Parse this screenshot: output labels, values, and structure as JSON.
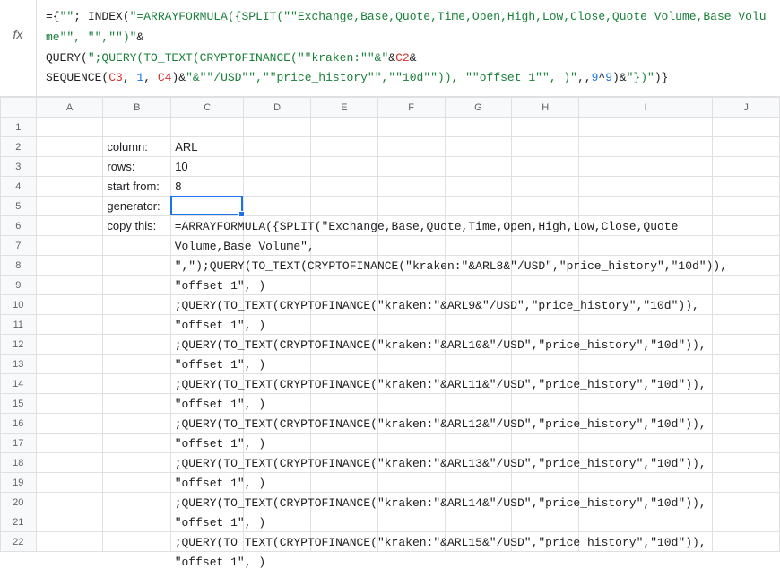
{
  "formula_bar": {
    "fx_label": "fx",
    "line1_part1": "={",
    "line1_str1": "\"\"",
    "line1_part2": "; INDEX(",
    "line1_str2": "\"=ARRAYFORMULA({SPLIT(\"\"Exchange,Base,Quote,Time,Open,High,Low,Close,Quote Volume,Base Volume\"\", \"\",\"\")\"",
    "line1_part3": "&",
    "line2_part1": "QUERY(",
    "line2_str1": "\";QUERY(TO_TEXT(CRYPTOFINANCE(\"\"kraken:\"\"&\"",
    "line2_part2": "&",
    "line2_ref1": "C2",
    "line2_part3": "&",
    "line3_part1": "SEQUENCE(",
    "line3_ref1": "C3",
    "line3_part2": ", ",
    "line3_num1": "1",
    "line3_part3": ", ",
    "line3_ref2": "C4",
    "line3_part4": ")&",
    "line3_str1": "\"&\"\"/USD\"\",\"\"price_history\"\",\"\"10d\"\")), \"\"offset 1\"\", )\"",
    "line3_part5": ",,",
    "line3_num2": "9",
    "line3_part6": "^",
    "line3_num3": "9",
    "line3_part7": ")&",
    "line3_str2": "\"})\"",
    "line3_part8": ")}"
  },
  "columns": [
    "A",
    "B",
    "C",
    "D",
    "E",
    "F",
    "G",
    "H",
    "I",
    "J"
  ],
  "row_count": 22,
  "cells": {
    "B2": "column:",
    "C2": "ARL",
    "B3": "rows:",
    "C3": "10",
    "B4": "start from:",
    "C4": "8",
    "B5": "generator:",
    "B6": "copy this:"
  },
  "overflow_c6": "=ARRAYFORMULA({SPLIT(\"Exchange,Base,Quote,Time,Open,High,Low,Close,Quote\nVolume,Base Volume\",\n\",\");QUERY(TO_TEXT(CRYPTOFINANCE(\"kraken:\"&ARL8&\"/USD\",\"price_history\",\"10d\")),\n\"offset 1\", )\n;QUERY(TO_TEXT(CRYPTOFINANCE(\"kraken:\"&ARL9&\"/USD\",\"price_history\",\"10d\")),\n\"offset 1\", )\n;QUERY(TO_TEXT(CRYPTOFINANCE(\"kraken:\"&ARL10&\"/USD\",\"price_history\",\"10d\")),\n\"offset 1\", )\n;QUERY(TO_TEXT(CRYPTOFINANCE(\"kraken:\"&ARL11&\"/USD\",\"price_history\",\"10d\")),\n\"offset 1\", )\n;QUERY(TO_TEXT(CRYPTOFINANCE(\"kraken:\"&ARL12&\"/USD\",\"price_history\",\"10d\")),\n\"offset 1\", )\n;QUERY(TO_TEXT(CRYPTOFINANCE(\"kraken:\"&ARL13&\"/USD\",\"price_history\",\"10d\")),\n\"offset 1\", )\n;QUERY(TO_TEXT(CRYPTOFINANCE(\"kraken:\"&ARL14&\"/USD\",\"price_history\",\"10d\")),\n\"offset 1\", )\n;QUERY(TO_TEXT(CRYPTOFINANCE(\"kraken:\"&ARL15&\"/USD\",\"price_history\",\"10d\")),\n\"offset 1\", )",
  "selected_cell": "C5"
}
